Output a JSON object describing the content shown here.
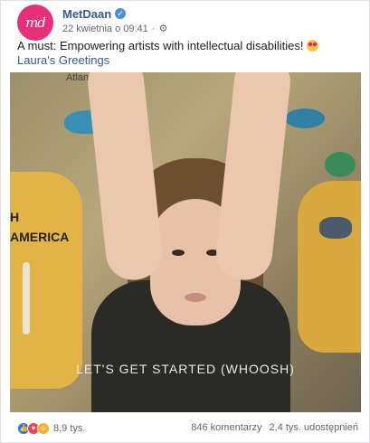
{
  "post": {
    "page_name": "MetDaan",
    "avatar_text": "md",
    "timestamp": "22 kwietnia o 09:41",
    "separator": "·",
    "text": "A must: Empowering artists with intellectual disabilities! ",
    "link": "Laura's Greetings"
  },
  "video": {
    "caption": "LET'S GET STARTED (WHOOSH)",
    "map_labels": [
      "H",
      "AMERICA",
      "Atlantic Ocean"
    ]
  },
  "footer": {
    "reaction_count": "8,9 tys.",
    "comments": "846 komentarzy",
    "shares": "2,4 tys. udostępnień",
    "reactions": [
      "like-icon",
      "love-icon",
      "haha-icon"
    ]
  },
  "colors": {
    "link": "#385898",
    "avatar": "#e6307a",
    "like": "#1877f2",
    "love": "#f33e58",
    "haha": "#f7b125"
  }
}
